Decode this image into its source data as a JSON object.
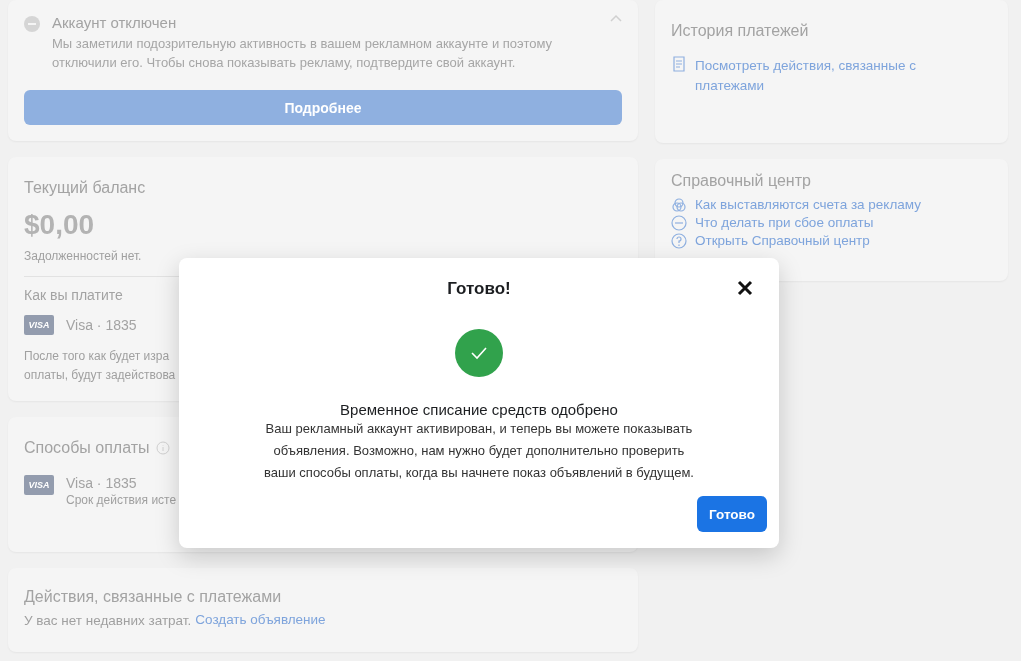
{
  "alert": {
    "title": "Аккаунт отключен",
    "text": "Мы заметили подозрительную активность в вашем рекламном аккаунте и поэтому отключили его. Чтобы снова показывать рекламу, подтвердите свой аккаунт.",
    "button": "Подробнее",
    "expanded": true
  },
  "balance": {
    "title": "Текущий баланс",
    "amount": "$0,00",
    "note": "Задолженностей нет.",
    "how_title": "Как вы платите",
    "card_brand": "VISA",
    "card": "Visa · 1835",
    "note_lines": [
      "После того как будет изра",
      "оплаты, будут задействова"
    ]
  },
  "methods": {
    "title": "Способы оплаты",
    "card_brand": "VISA",
    "card": "Visa · 1835",
    "expiry": "Срок действия исте"
  },
  "activity": {
    "title": "Действия, связанные с платежами",
    "text": "У вас нет недавних затрат.",
    "link": "Создать объявление"
  },
  "history": {
    "title": "История платежей",
    "link": "Посмотреть действия, связанные с платежами"
  },
  "help": {
    "title": "Справочный центр",
    "links": [
      {
        "kind": "billing",
        "text": "Как выставляются счета за рекламу"
      },
      {
        "kind": "failure",
        "text": "Что делать при сбое оплаты"
      },
      {
        "kind": "help",
        "text": "Открыть Справочный центр"
      }
    ]
  },
  "dialog": {
    "title": "Готово!",
    "heading": "Временное списание средств одобрено",
    "text": "Ваш рекламный аккаунт активирован, и теперь вы можете показывать объявления. Возможно, нам нужно будет дополнительно проверить ваши способы оплаты, когда вы начнете показ объявлений в будущем.",
    "button": "Готово"
  }
}
